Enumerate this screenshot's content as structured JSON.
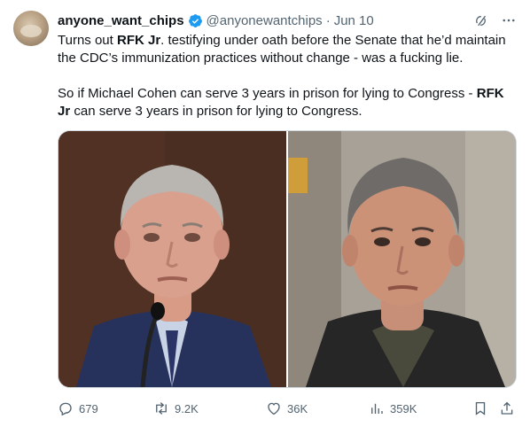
{
  "tweet": {
    "author_name": "anyone_want_chips",
    "handle": "@anyonewantchips",
    "separator": "·",
    "date": "Jun 10",
    "text_p1_a": "Turns out ",
    "text_p1_b": "RFK Jr",
    "text_p1_c": ". testifying under oath before the Senate that he’d maintain the CDC’s immunization practices without change - was a fucking lie.",
    "text_p2_a": "So if Michael Cohen can serve 3 years in prison for lying to Congress - ",
    "text_p2_b": "RFK Jr",
    "text_p2_c": " can serve 3 years in prison for lying to Congress."
  },
  "metrics": {
    "replies": "679",
    "reposts": "9.2K",
    "likes": "36K",
    "views": "359K"
  },
  "colors": {
    "verified": "#1d9bf0",
    "secondary_text": "#536471",
    "primary_text": "#0f1419"
  }
}
